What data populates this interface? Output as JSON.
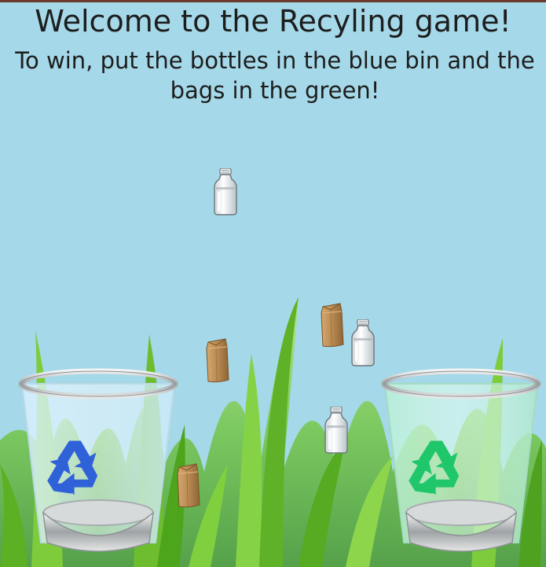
{
  "game": {
    "title": "Welcome to the Recyling game!",
    "instructions": "To win, put the bottles in the blue bin and the bags in the green!"
  },
  "colors": {
    "sky": "#a5d8e8",
    "grass_light": "#8fd14a",
    "grass_dark": "#3f9a1c",
    "blue_bin_symbol": "#2f62d8",
    "green_bin_symbol": "#1fc66a",
    "bag_brown": "#b98a52",
    "top_bar": "#6b3a2a"
  },
  "bins": [
    {
      "name": "blue recycle bin",
      "symbol_icon": "recycle-icon"
    },
    {
      "name": "green recycle bin",
      "symbol_icon": "recycle-icon"
    }
  ],
  "items": {
    "bottles": 3,
    "bags": 3
  }
}
